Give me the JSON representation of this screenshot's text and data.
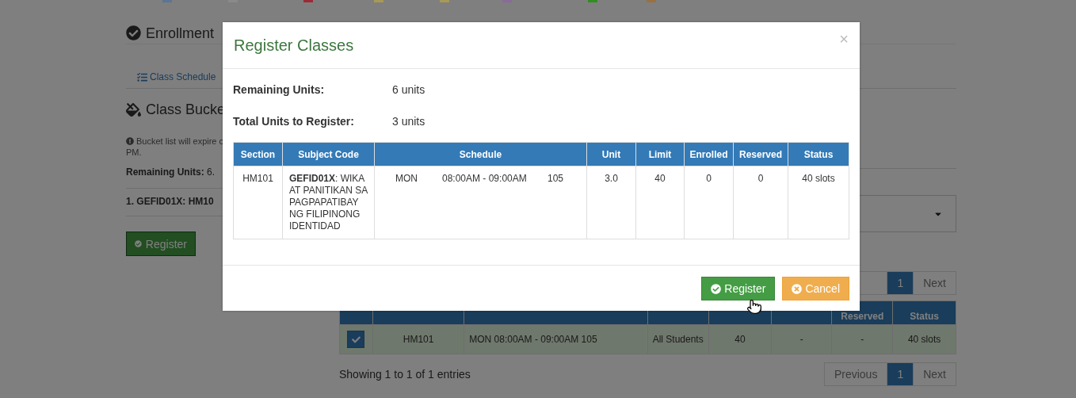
{
  "legend": [
    {
      "color": "#5a7595"
    },
    {
      "color": "#8a8a8a"
    },
    {
      "color": "#9c2a36"
    },
    {
      "color": "#a89a55"
    },
    {
      "color": "#a89a55"
    },
    {
      "color": "#8a6a9a"
    },
    {
      "color": "#2f8f1f"
    },
    {
      "color": "#9a7040"
    }
  ],
  "page": {
    "title": "Enrollment",
    "tab": "Class Schedule",
    "bucket_title": "Class Bucke",
    "notice_lines": [
      "Bucket list will expire c",
      "PM."
    ],
    "remaining": "**Remaining Units:** 6.",
    "bucket_items": [
      "1. GEFID01X: HM10"
    ],
    "register_button": "Register"
  },
  "class_table": {
    "top_pagination": [
      {
        "kind": "prev"
      },
      {
        "kind": "page",
        "label": "1",
        "selected": true
      },
      {
        "kind": "next",
        "label": "Next"
      }
    ],
    "headers": [
      {
        "kind": "check"
      },
      {
        "kind": "hidden"
      },
      {
        "kind": "hidden"
      },
      {
        "kind": "hidden"
      },
      {
        "kind": "hidden"
      },
      {
        "kind": "hidden"
      },
      {
        "kind": "text",
        "label": "Reserved"
      },
      {
        "kind": "text",
        "label": "Status"
      }
    ],
    "rows": [
      {
        "selected": true,
        "checked": true,
        "cells": [
          "HM101",
          "MON 08:00AM - 09:00AM 105",
          "All Students",
          "40",
          "-",
          "-",
          "40 slots"
        ]
      }
    ],
    "info": "Showing 1 to 1 of 1 entries",
    "bottom_pagination": [
      {
        "kind": "prev",
        "label": "Previous"
      },
      {
        "kind": "page",
        "label": "1",
        "selected": true
      },
      {
        "kind": "next",
        "label": "Next"
      }
    ]
  },
  "modal": {
    "title": "Register Classes",
    "close": "×",
    "summary": [
      {
        "label": "Remaining Units:",
        "value": "6 units"
      },
      {
        "label": "Total Units to Register:",
        "value": "3 units"
      }
    ],
    "columns": [
      "Section",
      "Subject Code",
      "Schedule",
      "Unit",
      "Limit",
      "Enrolled",
      "Reserved",
      "Status"
    ],
    "rows": [
      {
        "section": "HM101",
        "subject": "**GEFID01X**: WIKA AT PANITIKAN SA PAGPAPATIBAY NG FILIPINONG IDENTIDAD",
        "day": "MON",
        "time": "08:00AM - 09:00AM",
        "room": "105",
        "unit": "3.0",
        "limit": "40",
        "enrolled": "0",
        "reserved": "0",
        "status": "40 slots"
      }
    ],
    "buttons": [
      {
        "kind": "primary",
        "label": "Register"
      },
      {
        "kind": "warning",
        "label": "Cancel"
      }
    ]
  }
}
